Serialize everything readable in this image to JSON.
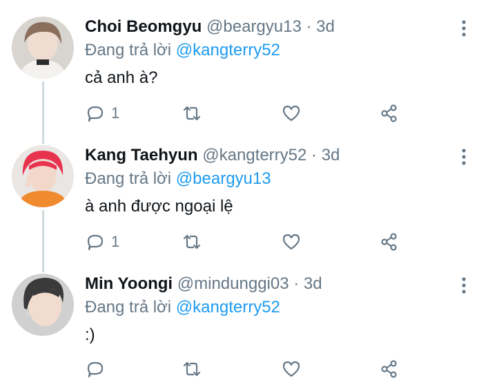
{
  "tweets": [
    {
      "name": "Choi Beomgyu",
      "handle": "@beargyu13",
      "separator": "·",
      "time": "3d",
      "replying_prefix": "Đang trả lời",
      "replying_to": "@kangterry52",
      "text": "cả anh à?",
      "reply_count": "1"
    },
    {
      "name": "Kang Taehyun",
      "handle": "@kangterry52",
      "separator": "·",
      "time": "3d",
      "replying_prefix": "Đang trả lời",
      "replying_to": "@beargyu13",
      "text": "à anh được ngoại lệ",
      "reply_count": "1"
    },
    {
      "name": "Min Yoongi",
      "handle": "@mindunggi03",
      "separator": "·",
      "time": "3d",
      "replying_prefix": "Đang trả lời",
      "replying_to": "@kangterry52",
      "text": ":)",
      "reply_count": ""
    }
  ],
  "icons": {
    "reply": "comment-icon",
    "retweet": "retweet-icon",
    "like": "heart-icon",
    "share": "share-icon",
    "more": "more-vertical-icon"
  },
  "colors": {
    "mention": "#1d9bf0",
    "secondary_text": "#657786",
    "thread_line": "#cfd9de"
  }
}
